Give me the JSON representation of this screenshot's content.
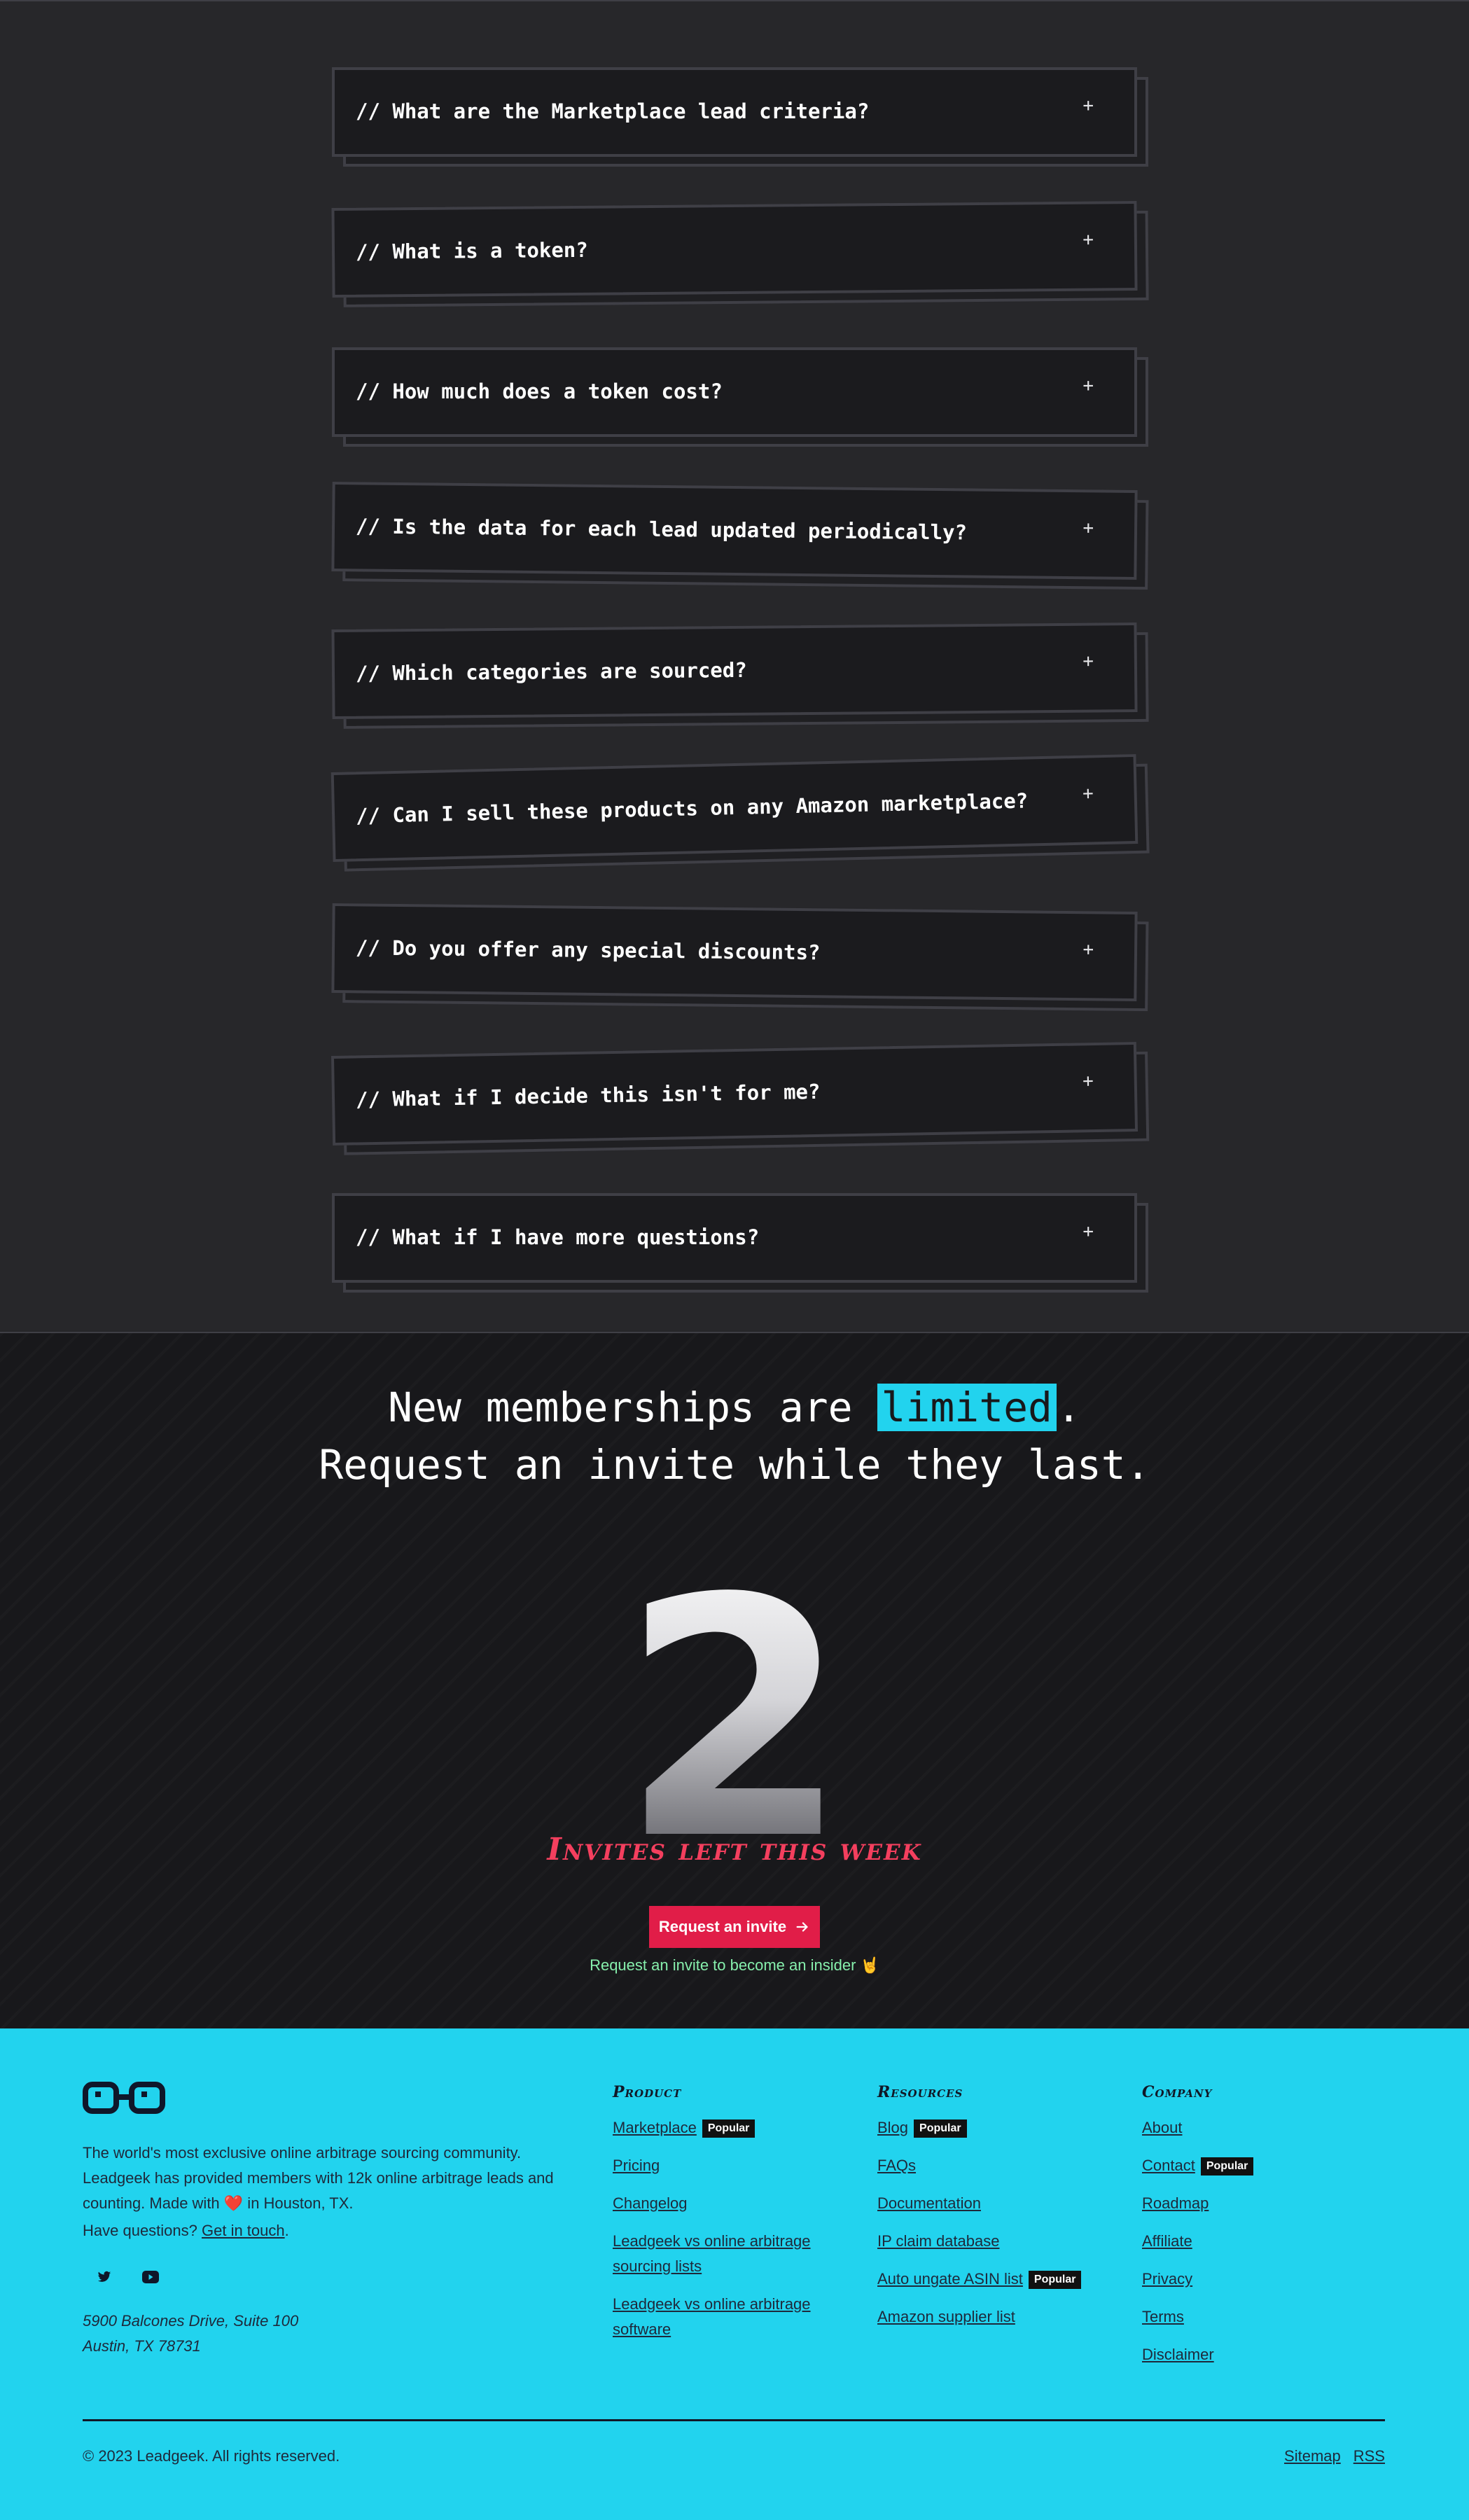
{
  "faq": {
    "items": [
      {
        "question": "// What are the Marketplace lead criteria?",
        "toggle": "+"
      },
      {
        "question": "// What is a token?",
        "toggle": "+"
      },
      {
        "question": "// How much does a token cost?",
        "toggle": "+"
      },
      {
        "question": "// Is the data for each lead updated periodically?",
        "toggle": "+"
      },
      {
        "question": "// Which categories are sourced?",
        "toggle": "+"
      },
      {
        "question": "// Can I sell these products on any Amazon marketplace?",
        "toggle": "+"
      },
      {
        "question": "// Do you offer any special discounts?",
        "toggle": "+"
      },
      {
        "question": "// What if I decide this isn't for me?",
        "toggle": "+"
      },
      {
        "question": "// What if I have more questions?",
        "toggle": "+"
      }
    ]
  },
  "cta": {
    "headline_prefix": "New memberships are ",
    "headline_highlight": "limited",
    "headline_suffix": ".",
    "headline_line2": "Request an invite while they last.",
    "invites_count": "2",
    "invites_label": "Invites left this week",
    "button_label": "Request an invite",
    "button_icon": "arrow-right-icon",
    "subtext": "Request an invite to become an insider 🤘",
    "highlight_color": "#22d3ee",
    "button_color": "#e11d48"
  },
  "footer": {
    "logo_icon": "glasses-icon",
    "about_prefix": "The world's most exclusive online arbitrage sourcing community. Leadgeek has provided members with 12k online arbitrage leads and counting. Made with ",
    "about_heart": "❤️",
    "about_suffix": " in Houston, TX.",
    "questions_prefix": "Have questions? ",
    "questions_link": "Get in touch",
    "questions_suffix": ".",
    "social": [
      "twitter-icon",
      "youtube-icon"
    ],
    "address_line1": "5900 Balcones Drive, Suite 100",
    "address_line2": "Austin, TX 78731",
    "columns": [
      {
        "heading": "Product",
        "links": [
          {
            "label": "Marketplace",
            "badge": "Popular"
          },
          {
            "label": "Pricing",
            "badge": ""
          },
          {
            "label": "Changelog",
            "badge": ""
          },
          {
            "label": "Leadgeek vs online arbitrage sourcing lists",
            "badge": ""
          },
          {
            "label": "Leadgeek vs online arbitrage software",
            "badge": ""
          }
        ]
      },
      {
        "heading": "Resources",
        "links": [
          {
            "label": "Blog",
            "badge": "Popular"
          },
          {
            "label": "FAQs",
            "badge": ""
          },
          {
            "label": "Documentation",
            "badge": ""
          },
          {
            "label": "IP claim database",
            "badge": ""
          },
          {
            "label": "Auto ungate ASIN list",
            "badge": "Popular"
          },
          {
            "label": "Amazon supplier list",
            "badge": ""
          }
        ]
      },
      {
        "heading": "Company",
        "links": [
          {
            "label": "About",
            "badge": ""
          },
          {
            "label": "Contact",
            "badge": "Popular"
          },
          {
            "label": "Roadmap",
            "badge": ""
          },
          {
            "label": "Affiliate",
            "badge": ""
          },
          {
            "label": "Privacy",
            "badge": ""
          },
          {
            "label": "Terms",
            "badge": ""
          },
          {
            "label": "Disclaimer",
            "badge": ""
          }
        ]
      }
    ],
    "copyright": "© 2023 Leadgeek. All rights reserved.",
    "bottom_links": [
      "Sitemap",
      "RSS"
    ],
    "background_color": "#22d3ee"
  }
}
